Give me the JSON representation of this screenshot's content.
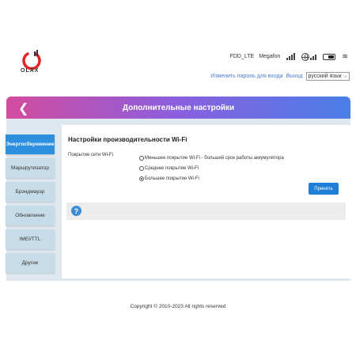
{
  "header": {
    "logo_text": "OLAX",
    "network_type": "FDD_LTE",
    "operator": "Megafon",
    "change_password": "Изменить пароль для входа",
    "logout": "Выход",
    "language": "русский язык"
  },
  "banner": {
    "title": "Дополнительные настройки",
    "back_icon": "chevron-left-icon"
  },
  "sidebar": {
    "items": [
      {
        "label": "Энергосбережение",
        "active": true
      },
      {
        "label": "Маршрутизатор",
        "active": false
      },
      {
        "label": "Брэндмауэр",
        "active": false
      },
      {
        "label": "Обновление",
        "active": false
      },
      {
        "label": "IMEI/TTL",
        "active": false
      },
      {
        "label": "Другие",
        "active": false
      }
    ]
  },
  "main": {
    "section_title": "Настройки производительности Wi-Fi",
    "field_label": "Покрытие сети Wi-Fi",
    "options": [
      {
        "label": "Меньшее покрытие Wi-Fi - больший срок работы аккумулятора",
        "selected": false
      },
      {
        "label": "Среднее покрытие Wi-Fi",
        "selected": false
      },
      {
        "label": "Большее покрытие Wi-Fi",
        "selected": true
      }
    ],
    "apply_label": "Принять",
    "help_icon": "?"
  },
  "footer": {
    "copyright": "Copyright © 2010-2023 All rights reserved"
  },
  "colors": {
    "accent": "#1f7fd6",
    "active_tab": "#2d8fe0",
    "banner_start": "#d34c9e",
    "banner_end": "#4a7ee6",
    "logo_red": "#e0242a"
  }
}
